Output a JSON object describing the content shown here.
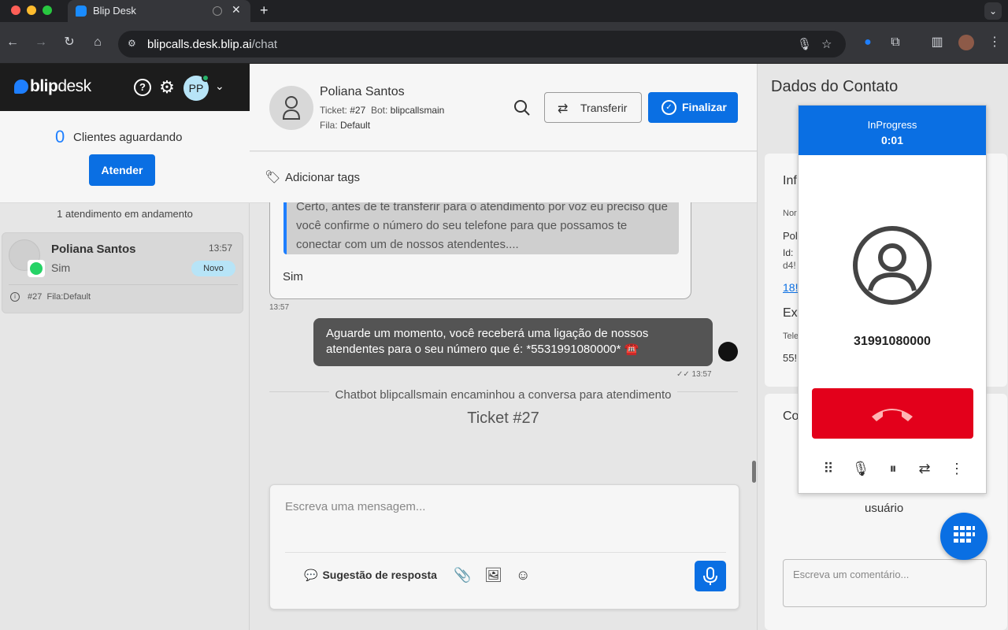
{
  "browser": {
    "tab_title": "Blip Desk",
    "url_host": "blipcalls.desk.blip.ai",
    "url_path": "/chat"
  },
  "brand": {
    "name_bold": "blip",
    "name_light": "desk",
    "avatar_initials": "PP"
  },
  "queue": {
    "count": "0",
    "label": "Clientes aguardando",
    "button": "Atender"
  },
  "sidebar": {
    "in_progress_label": "1 atendimento em andamento",
    "conversation": {
      "name": "Poliana Santos",
      "time": "13:57",
      "last_message": "Sim",
      "badge": "Novo",
      "ticket": "#27",
      "queue": "Fila:Default"
    }
  },
  "chat_header": {
    "contact_name": "Poliana Santos",
    "ticket_label": "Ticket:",
    "ticket_value": "#27",
    "bot_label": "Bot:",
    "bot_value": "blipcallsmain",
    "queue_label": "Fila:",
    "queue_value": "Default",
    "transfer_button": "Transferir",
    "finish_button": "Finalizar",
    "tags_label": "Adicionar tags"
  },
  "messages": {
    "quoted_text": "Certo, antes de te transferir para o atendimento por voz eu preciso que você confirme o número do seu telefone para que possamos te conectar com um de nossos atendentes....",
    "reply": "Sim",
    "reply_time": "13:57",
    "bot_text": "Aguarde um momento, você receberá uma ligação de nossos atendentes para o seu número que é: *5531991080000* ☎️",
    "bot_time": "13:57",
    "system_text": "Chatbot blipcallsmain encaminhou a conversa para atendimento",
    "ticket_label": "Ticket #27"
  },
  "composer": {
    "placeholder": "Escreva uma mensagem...",
    "suggestion_label": "Sugestão de resposta"
  },
  "contact_panel": {
    "title": "Dados do Contato",
    "info_title": "Inf",
    "name_label": "Nor",
    "name_value": "Pol",
    "id_label": "Id:",
    "id_value": "d4!",
    "link": "18!",
    "extra_title": "Ext",
    "phone_label": "Tele",
    "phone_value": "55!",
    "comments_title": "Co",
    "comments_user": "usuário",
    "comment_placeholder": "Escreva um comentário..."
  },
  "call": {
    "status": "InProgress",
    "timer": "0:01",
    "number": "31991080000"
  },
  "colors": {
    "accent": "#0a6fe3",
    "hangup": "#e3001b",
    "dark_bar": "#1c1c1c"
  }
}
